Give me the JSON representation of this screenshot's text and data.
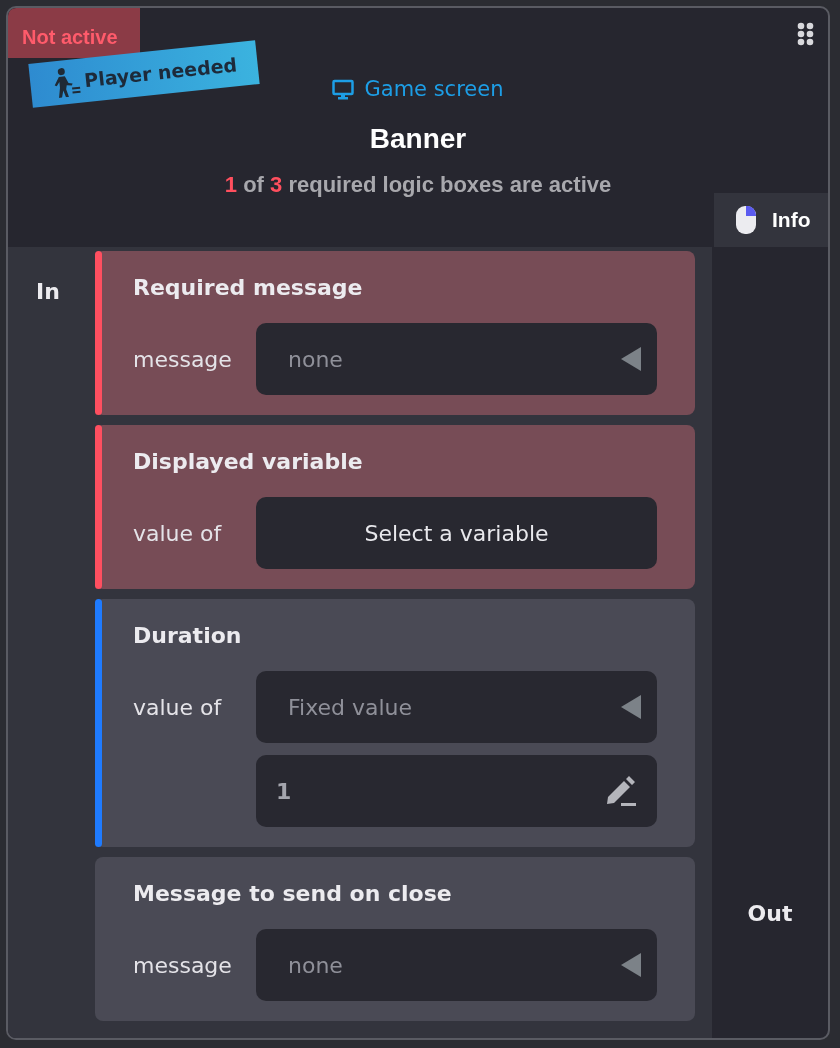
{
  "header": {
    "badge": "Not active",
    "ribbon": "Player needed",
    "category": "Game screen",
    "title": "Banner",
    "status": {
      "active": "1",
      "of": "of",
      "required": "3",
      "rest": "required logic boxes are active"
    },
    "info_tab": "Info"
  },
  "in_label": "In",
  "out_label": "Out",
  "cards": [
    {
      "title": "Required message",
      "kind": "error",
      "rows": [
        {
          "label": "message",
          "field": {
            "kind": "dropdown",
            "text": "none"
          }
        }
      ]
    },
    {
      "title": "Displayed variable",
      "kind": "error",
      "rows": [
        {
          "label": "value of",
          "field": {
            "kind": "button",
            "text": "Select a variable"
          }
        }
      ]
    },
    {
      "title": "Duration",
      "kind": "ok",
      "rows": [
        {
          "label": "value of",
          "field": {
            "kind": "dropdown",
            "text": "Fixed value"
          }
        },
        {
          "field": {
            "kind": "number",
            "value": "1"
          }
        }
      ]
    },
    {
      "title": "Message to send on close",
      "kind": "plain",
      "rows": [
        {
          "label": "message",
          "field": {
            "kind": "dropdown",
            "text": "none"
          }
        }
      ]
    }
  ]
}
